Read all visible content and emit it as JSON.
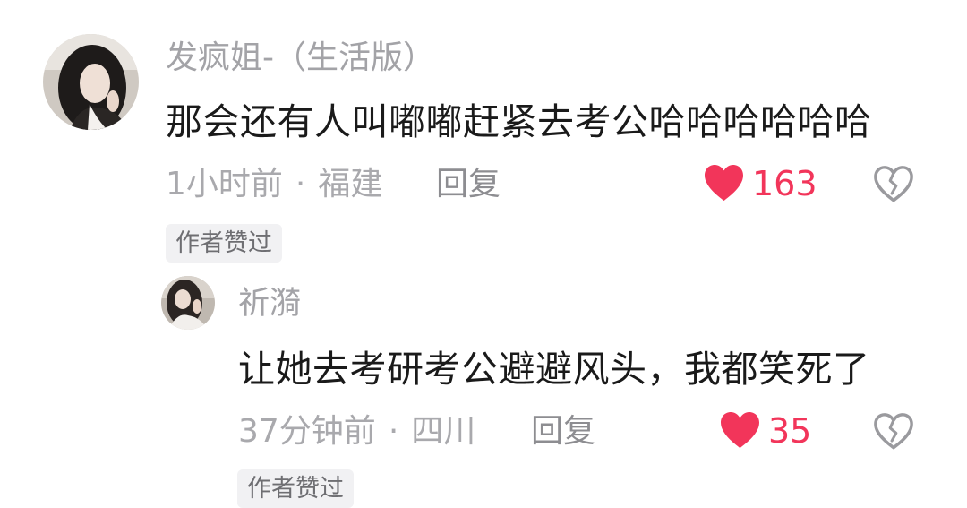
{
  "comment": {
    "username": "发疯姐-（生活版）",
    "text": "那会还有人叫嘟嘟赶紧去考公哈哈哈哈哈哈",
    "time": "1小时前",
    "location": "福建",
    "separator": "·",
    "reply_label": "回复",
    "like_count": "163",
    "author_liked_badge": "作者赞过"
  },
  "reply": {
    "username": "祈漪",
    "text": "让她去考研考公避避风头，我都笑死了",
    "time": "37分钟前",
    "location": "四川",
    "separator": "·",
    "reply_label": "回复",
    "like_count": "35",
    "author_liked_badge": "作者赞过"
  },
  "colors": {
    "like_red": "#f2355a",
    "muted_text": "#a9a9ad",
    "body_text": "#1a1a1a",
    "badge_bg": "#f1f1f3"
  },
  "icons": {
    "like": "heart-filled-icon",
    "dislike": "broken-heart-icon"
  }
}
